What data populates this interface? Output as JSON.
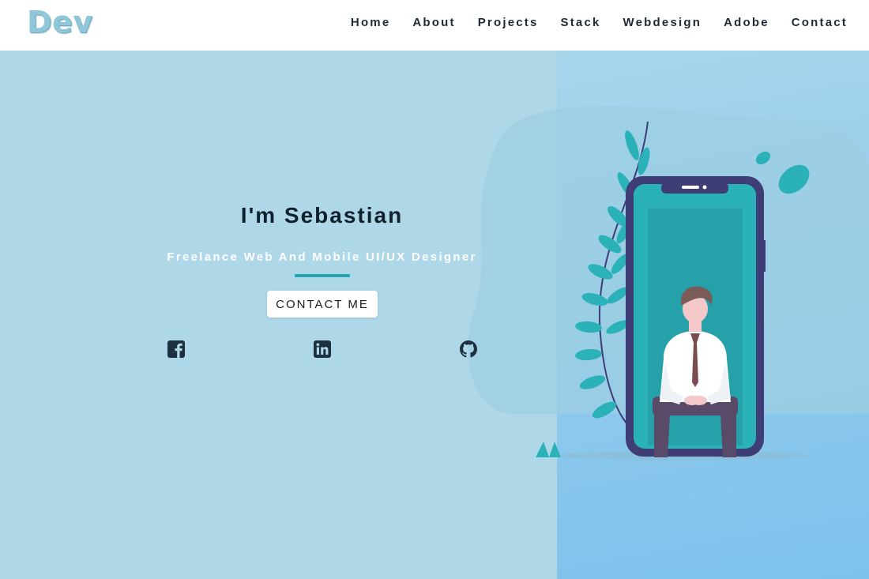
{
  "logo": {
    "text": "Dev"
  },
  "nav": {
    "items": [
      {
        "label": "Home"
      },
      {
        "label": "About"
      },
      {
        "label": "Projects"
      },
      {
        "label": "Stack"
      },
      {
        "label": "Webdesign"
      },
      {
        "label": "Adobe"
      },
      {
        "label": "Contact"
      }
    ]
  },
  "hero": {
    "title": "I'm Sebastian",
    "subtitle": "Freelance Web And Mobile UI/UX Designer",
    "cta_label": "CONTACT ME",
    "social": [
      {
        "icon": "facebook-icon"
      },
      {
        "icon": "linkedin-icon"
      },
      {
        "icon": "github-icon"
      }
    ],
    "illustration": "person-sitting-in-phone-illustration"
  },
  "colors": {
    "hero_background": "#aed7e8",
    "accent": "#22a6b1",
    "phone_frame": "#3f3d76",
    "icon_dark": "#1d3040"
  }
}
